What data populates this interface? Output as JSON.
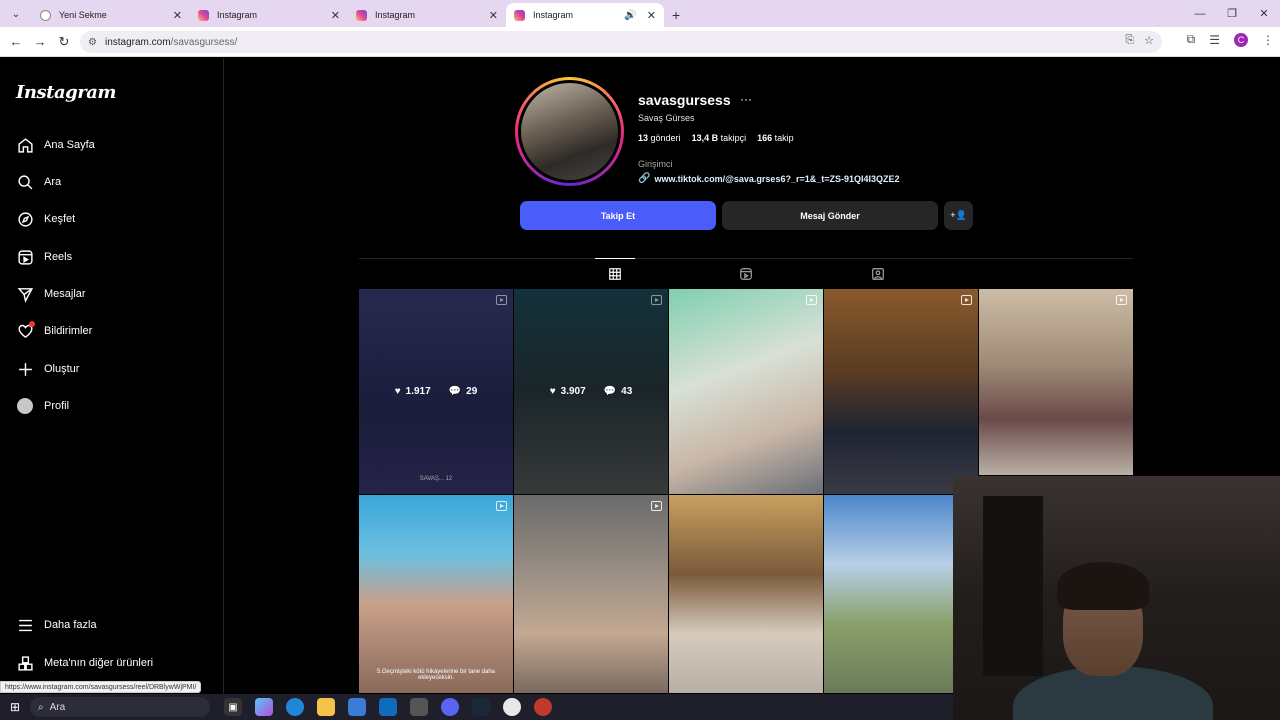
{
  "browser": {
    "tabs": [
      {
        "label": "Yeni Sekme",
        "favicon": "globe-icon",
        "active": false
      },
      {
        "label": "Instagram",
        "favicon": "instagram-icon",
        "active": false
      },
      {
        "label": "Instagram",
        "favicon": "instagram-icon",
        "active": false
      },
      {
        "label": "Instagram",
        "favicon": "instagram-icon",
        "active": true
      }
    ],
    "url_host": "instagram.com",
    "url_path": "/savasgursess/",
    "profile_initial": "C",
    "status_url": "https://www.instagram.com/savasgursess/reel/DRBlywWjPMI/"
  },
  "sidebar": {
    "logo": "Instagram",
    "items": [
      {
        "label": "Ana Sayfa",
        "icon": "home-icon"
      },
      {
        "label": "Ara",
        "icon": "search-icon"
      },
      {
        "label": "Keşfet",
        "icon": "compass-icon"
      },
      {
        "label": "Reels",
        "icon": "reels-icon"
      },
      {
        "label": "Mesajlar",
        "icon": "messages-icon"
      },
      {
        "label": "Bildirimler",
        "icon": "heart-icon"
      },
      {
        "label": "Oluştur",
        "icon": "plus-icon"
      },
      {
        "label": "Profil",
        "icon": "profile-icon"
      }
    ],
    "more_label": "Daha fazla",
    "meta_label": "Meta'nın diğer ürünleri"
  },
  "profile": {
    "username": "savasgursess",
    "more": "···",
    "full_name": "Savaş Gürses",
    "stats": {
      "posts_value": "13",
      "posts_label": "gönderi",
      "followers_value": "13,4 B",
      "followers_label": "takipçi",
      "following_value": "166",
      "following_label": "takip"
    },
    "category": "Girişimci",
    "bio_link": "www.tiktok.com/@sava.grses6?_r=1&_t=ZS-91QI4I3QZE2",
    "follow_button": "Takip Et",
    "message_button": "Mesaj Gönder",
    "add_user_icon": "add-user-icon"
  },
  "tabs": [
    {
      "name": "posts",
      "icon": "grid-icon",
      "active": true
    },
    {
      "name": "reels",
      "icon": "reels-icon",
      "active": false
    },
    {
      "name": "tagged",
      "icon": "tagged-icon",
      "active": false
    }
  ],
  "grid": [
    {
      "likes": "1.917",
      "comments": "29",
      "hover": true,
      "caption": "SAVAŞ... 12"
    },
    {
      "likes": "3.907",
      "comments": "43",
      "hover": true,
      "caption": ""
    },
    {
      "hover": false
    },
    {
      "hover": false
    },
    {
      "hover": false
    },
    {
      "hover": false,
      "caption": "5.Geçmişteki kötü hikayelerine bir tane daha ekleyeceksin."
    },
    {
      "hover": false,
      "caption": ""
    },
    {
      "hover": false
    },
    {
      "hover": false
    }
  ],
  "taskbar": {
    "search_label": "Ara"
  },
  "colors": {
    "follow_button": "#4a5df9",
    "secondary_button": "#262626",
    "notification_dot": "#ff3040",
    "link": "#e0f1ff"
  }
}
